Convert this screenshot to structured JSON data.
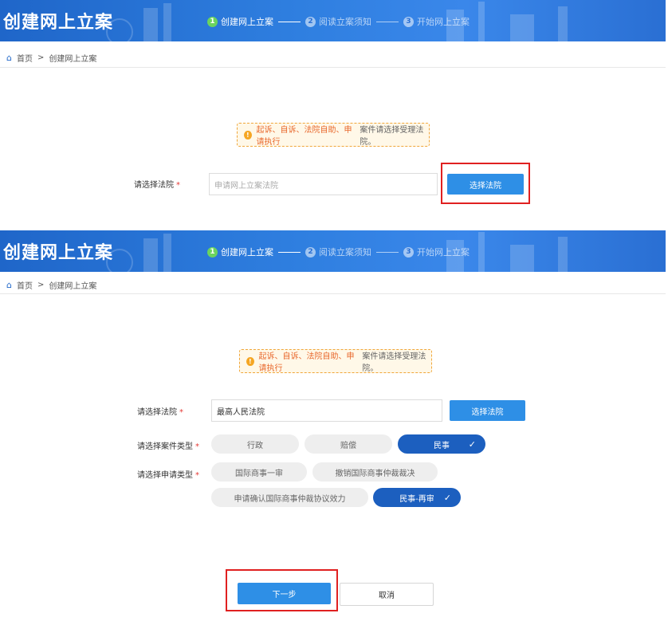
{
  "panel1": {
    "banner_title": "创建网上立案",
    "steps": [
      {
        "num": "1",
        "label": "创建网上立案"
      },
      {
        "num": "2",
        "label": "阅读立案须知"
      },
      {
        "num": "3",
        "label": "开始网上立案"
      }
    ],
    "breadcrumb": {
      "home": "首页",
      "sep": ">",
      "current": "创建网上立案"
    },
    "notice": {
      "highlight": "起诉、自诉、法院自助、申请执行",
      "rest": "案件请选择受理法院。"
    },
    "court_label": "请选择法院",
    "court_input_placeholder": "申请网上立案法院",
    "select_court_button": "选择法院"
  },
  "panel2": {
    "banner_title": "创建网上立案",
    "steps": [
      {
        "num": "1",
        "label": "创建网上立案"
      },
      {
        "num": "2",
        "label": "阅读立案须知"
      },
      {
        "num": "3",
        "label": "开始网上立案"
      }
    ],
    "breadcrumb": {
      "home": "首页",
      "sep": ">",
      "current": "创建网上立案"
    },
    "notice": {
      "highlight": "起诉、自诉、法院自助、申请执行",
      "rest": "案件请选择受理法院。"
    },
    "court_label": "请选择法院",
    "court_input_value": "最高人民法院",
    "select_court_button": "选择法院",
    "case_type_label": "请选择案件类型",
    "case_types": [
      "行政",
      "赔偿",
      "民事"
    ],
    "case_type_selected": "民事",
    "apply_type_label": "请选择申请类型",
    "apply_types": [
      "国际商事一审",
      "撤销国际商事仲裁裁决",
      "申请确认国际商事仲裁协议效力",
      "民事-再审"
    ],
    "apply_type_selected": "民事-再审",
    "next_button": "下一步",
    "cancel_button": "取消"
  },
  "icons": {
    "home": "home-icon",
    "warning": "warning-icon",
    "check": "check-icon"
  },
  "colors": {
    "banner": "#2a6fd3",
    "primary_button": "#2e8fe6",
    "selected_pill": "#1c5fbf",
    "highlight_box": "#e02020",
    "notice_border": "#f0a63a"
  }
}
